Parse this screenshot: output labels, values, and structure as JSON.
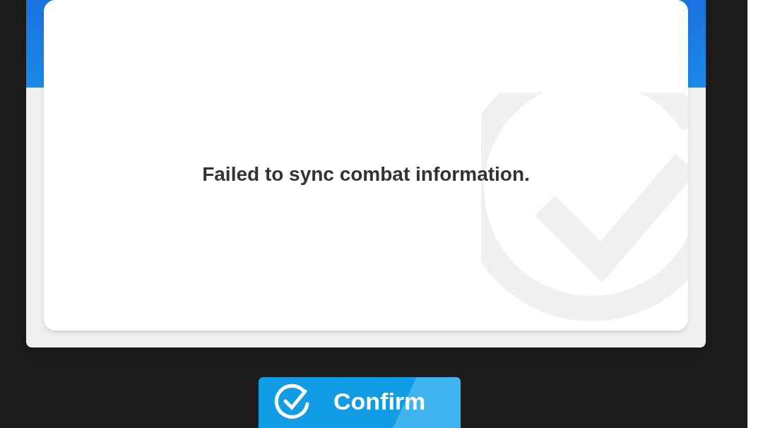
{
  "dialog": {
    "message": "Failed to sync combat information."
  },
  "buttons": [
    {
      "label": "Confirm",
      "kind": "confirm"
    }
  ]
}
